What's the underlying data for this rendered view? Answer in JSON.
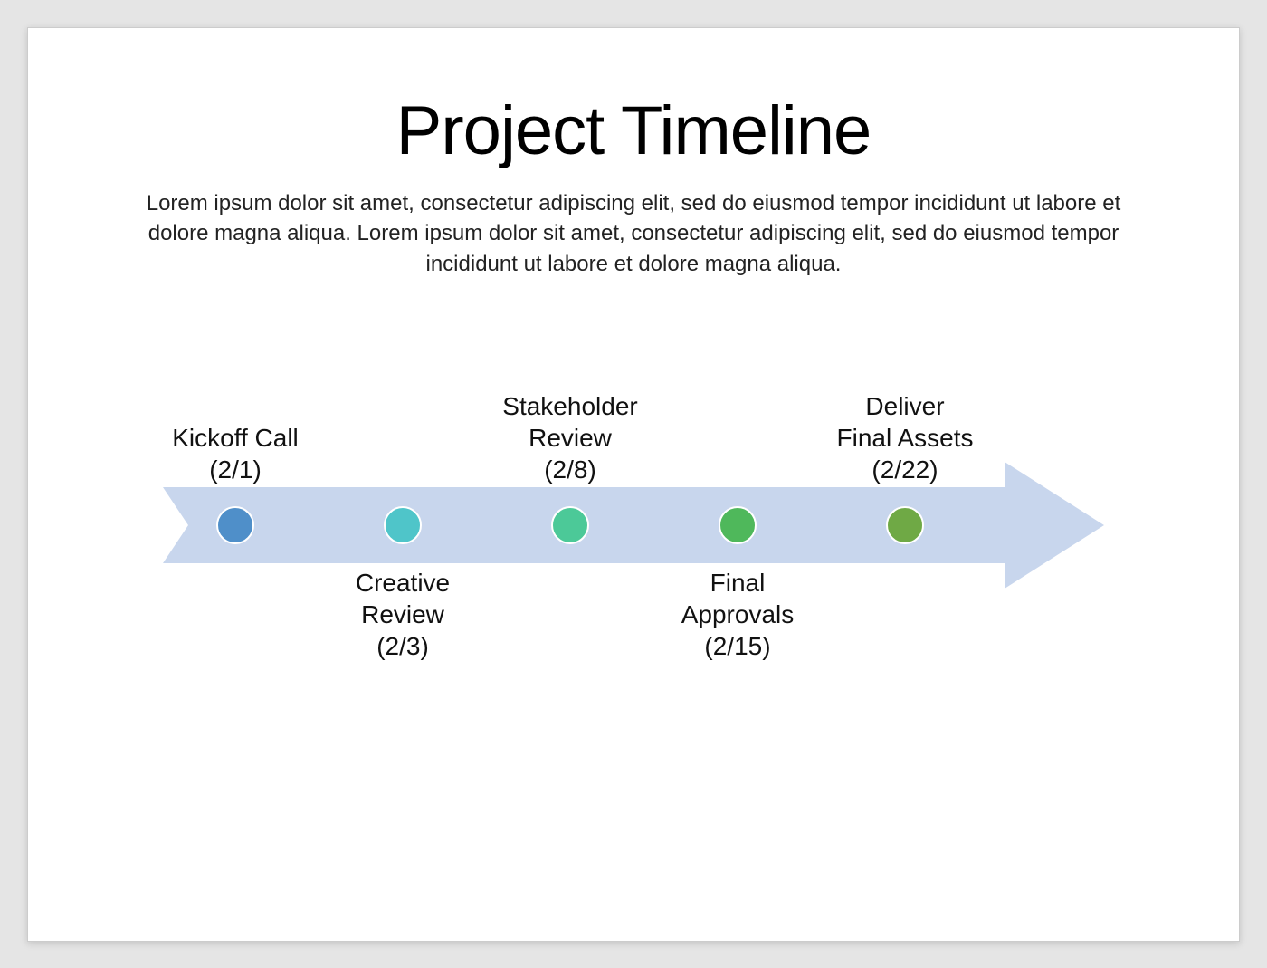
{
  "title": "Project Timeline",
  "subtitle": "Lorem ipsum dolor sit amet, consectetur adipiscing elit, sed do eiusmod tempor incididunt ut labore et dolore magna aliqua. Lorem ipsum dolor sit amet, consectetur adipiscing elit, sed do eiusmod tempor incididunt ut labore et dolore magna aliqua.",
  "arrow_color": "#c8d6ed",
  "milestones": [
    {
      "label": "Kickoff Call\n(2/1)",
      "position": "top",
      "dot_color": "#4f8fc9"
    },
    {
      "label": "Creative\nReview\n(2/3)",
      "position": "bottom",
      "dot_color": "#4fc5c9"
    },
    {
      "label": "Stakeholder\nReview\n(2/8)",
      "position": "top",
      "dot_color": "#4cc998"
    },
    {
      "label": "Final\nApprovals\n(2/15)",
      "position": "bottom",
      "dot_color": "#4fb85b"
    },
    {
      "label": "Deliver\nFinal Assets\n(2/22)",
      "position": "top",
      "dot_color": "#6fa945"
    }
  ]
}
